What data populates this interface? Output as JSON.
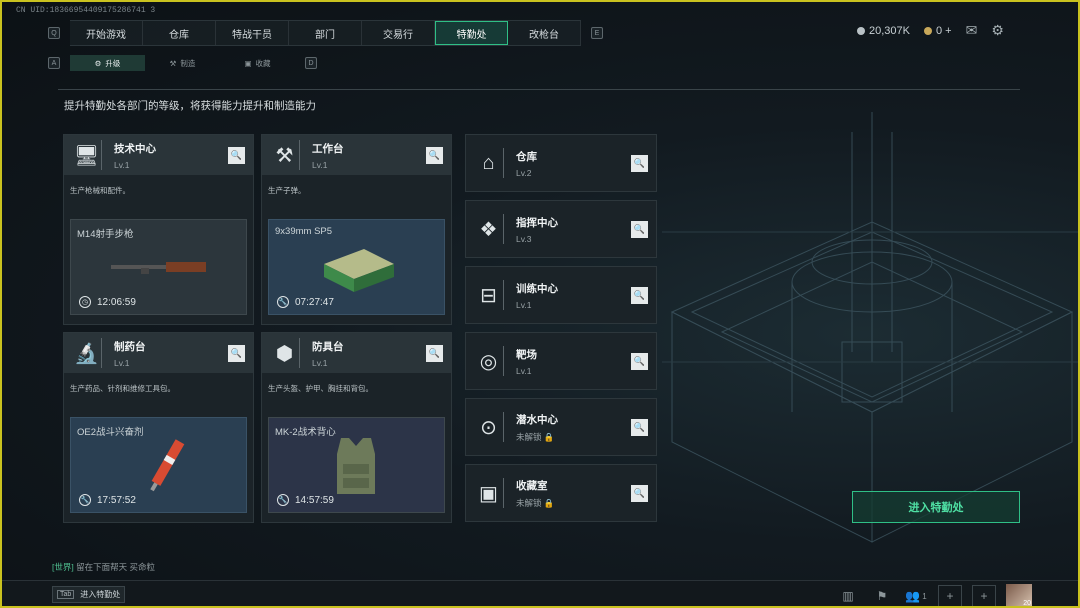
{
  "uid": "CN UID:18366954409175286741 3",
  "nav": {
    "left_key": "Q",
    "right_key": "E",
    "tabs": [
      "开始游戏",
      "仓库",
      "特战干员",
      "部门",
      "交易行",
      "特勤处",
      "改枪台"
    ],
    "active_tab": "特勤处"
  },
  "wallet": {
    "silver": "20,307K",
    "gold": "0",
    "gold_add": "+"
  },
  "subnav": {
    "left_key": "A",
    "right_key": "D",
    "tabs": [
      "升级",
      "制造",
      "收藏"
    ],
    "active_tab": "升级"
  },
  "description": "提升特勤处各部门的等级，将获得能力提升和制造能力",
  "cards": [
    {
      "name": "技术中心",
      "level": "Lv.1",
      "desc": "生产枪械和配件。",
      "item": "M14射手步枪",
      "time": "12:06:59"
    },
    {
      "name": "工作台",
      "level": "Lv.1",
      "desc": "生产子弹。",
      "item": "9x39mm SP5",
      "time": "07:27:47"
    },
    {
      "name": "制药台",
      "level": "Lv.1",
      "desc": "生产药品、针剂和维修工具包。",
      "item": "OE2战斗兴奋剂",
      "time": "17:57:52"
    },
    {
      "name": "防具台",
      "level": "Lv.1",
      "desc": "生产头盔、护甲、胸挂和背包。",
      "item": "MK-2战术背心",
      "time": "14:57:59"
    }
  ],
  "side_cards": [
    {
      "name": "仓库",
      "level": "Lv.2"
    },
    {
      "name": "指挥中心",
      "level": "Lv.3"
    },
    {
      "name": "训练中心",
      "level": "Lv.1"
    },
    {
      "name": "靶场",
      "level": "Lv.1"
    },
    {
      "name": "潜水中心",
      "level": "未解锁"
    },
    {
      "name": "收藏室",
      "level": "未解锁"
    }
  ],
  "enter_button": "进入特勤处",
  "chat": {
    "channel": "[世界]",
    "message": "留在下面帮天 买命粒"
  },
  "bottom": {
    "key": "Tab",
    "label": "进入特勤处",
    "friends": "1",
    "level": "20"
  }
}
